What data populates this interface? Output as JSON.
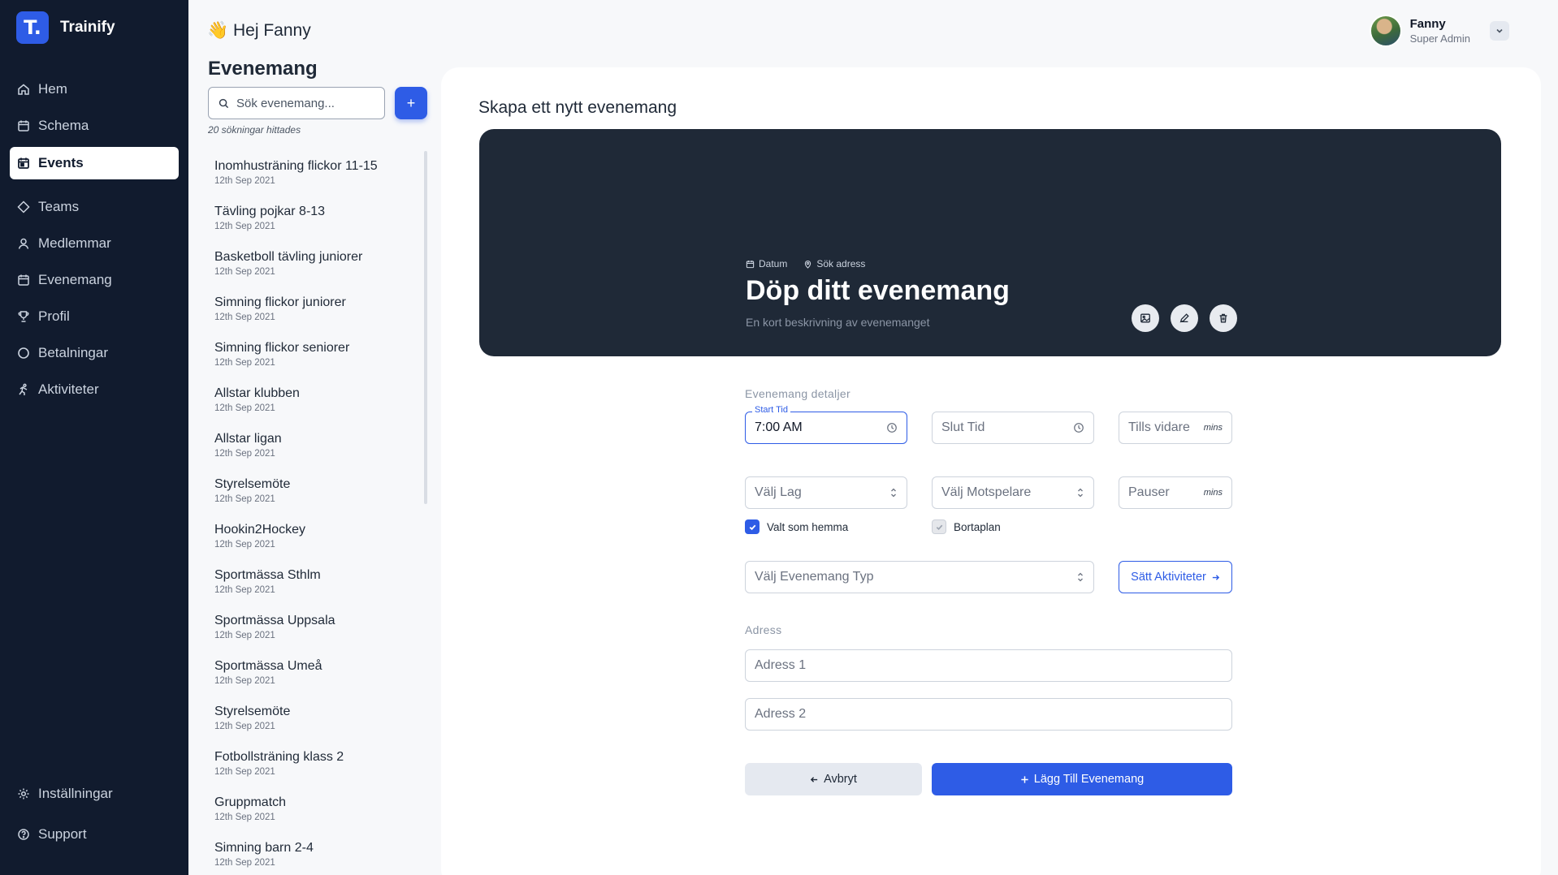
{
  "brand": {
    "logo": "T.",
    "name": "Trainify"
  },
  "nav": {
    "items": [
      {
        "label": "Hem",
        "icon": "home-icon"
      },
      {
        "label": "Schema",
        "icon": "calendar-icon"
      },
      {
        "label": "Events",
        "icon": "calendar-check-icon",
        "active": true
      },
      {
        "label": "Teams",
        "icon": "diamond-icon"
      },
      {
        "label": "Medlemmar",
        "icon": "user-icon"
      },
      {
        "label": "Evenemang",
        "icon": "calendar-icon"
      },
      {
        "label": "Profil",
        "icon": "trophy-icon"
      },
      {
        "label": "Betalningar",
        "icon": "circle-icon"
      },
      {
        "label": "Aktiviteter",
        "icon": "running-icon"
      }
    ],
    "bottom": [
      {
        "label": "Inställningar",
        "icon": "gear-icon"
      },
      {
        "label": "Support",
        "icon": "help-icon"
      }
    ]
  },
  "header": {
    "greeting_emoji": "👋",
    "greeting": "Hej Fanny"
  },
  "user": {
    "name": "Fanny",
    "role": "Super Admin"
  },
  "events": {
    "title": "Evenemang",
    "search_placeholder": "Sök evenemang...",
    "add_label": "+",
    "hits": "20 sökningar hittades",
    "items": [
      {
        "title": "Inomhusträning flickor 11-15",
        "date": "12th Sep 2021"
      },
      {
        "title": "Tävling pojkar 8-13",
        "date": "12th Sep 2021"
      },
      {
        "title": "Basketboll tävling juniorer",
        "date": "12th Sep 2021"
      },
      {
        "title": "Simning flickor juniorer",
        "date": "12th Sep 2021"
      },
      {
        "title": "Simning flickor seniorer",
        "date": "12th Sep 2021"
      },
      {
        "title": "Allstar klubben",
        "date": "12th Sep 2021"
      },
      {
        "title": "Allstar ligan",
        "date": "12th Sep 2021"
      },
      {
        "title": "Styrelsemöte",
        "date": "12th Sep 2021"
      },
      {
        "title": "Hookin2Hockey",
        "date": "12th Sep 2021"
      },
      {
        "title": "Sportmässa Sthlm",
        "date": "12th Sep 2021"
      },
      {
        "title": "Sportmässa Uppsala",
        "date": "12th Sep 2021"
      },
      {
        "title": "Sportmässa Umeå",
        "date": "12th Sep 2021"
      },
      {
        "title": "Styrelsemöte",
        "date": "12th Sep 2021"
      },
      {
        "title": "Fotbollsträning klass 2",
        "date": "12th Sep 2021"
      },
      {
        "title": "Gruppmatch",
        "date": "12th Sep 2021"
      },
      {
        "title": "Simning barn 2-4",
        "date": "12th Sep 2021"
      }
    ]
  },
  "form": {
    "title": "Skapa ett nytt evenemang",
    "banner": {
      "date_label": "Datum",
      "address_label": "Sök adress",
      "title": "Döp ditt evenemang",
      "description": "En kort beskrivning av evenemanget"
    },
    "details_label": "Evenemang detaljer",
    "start_time_label": "Start Tid",
    "start_time_value": "7:00 AM",
    "end_time_placeholder": "Slut Tid",
    "until_placeholder": "Tills vidare",
    "until_suffix": "mins",
    "team_placeholder": "Välj Lag",
    "opponent_placeholder": "Välj Motspelare",
    "breaks_placeholder": "Pauser",
    "breaks_suffix": "mins",
    "home_checkbox": "Valt som hemma",
    "away_checkbox": "Bortaplan",
    "event_type_placeholder": "Välj Evenemang Typ",
    "set_activities": "Sätt Aktiviteter",
    "address_label": "Adress",
    "address1_placeholder": "Adress 1",
    "address2_placeholder": "Adress 2",
    "cancel": "Avbryt",
    "submit": "Lägg Till Evenemang"
  },
  "colors": {
    "sidebar": "#111b2e",
    "accent": "#2e5ce6",
    "banner": "#1f2937"
  }
}
